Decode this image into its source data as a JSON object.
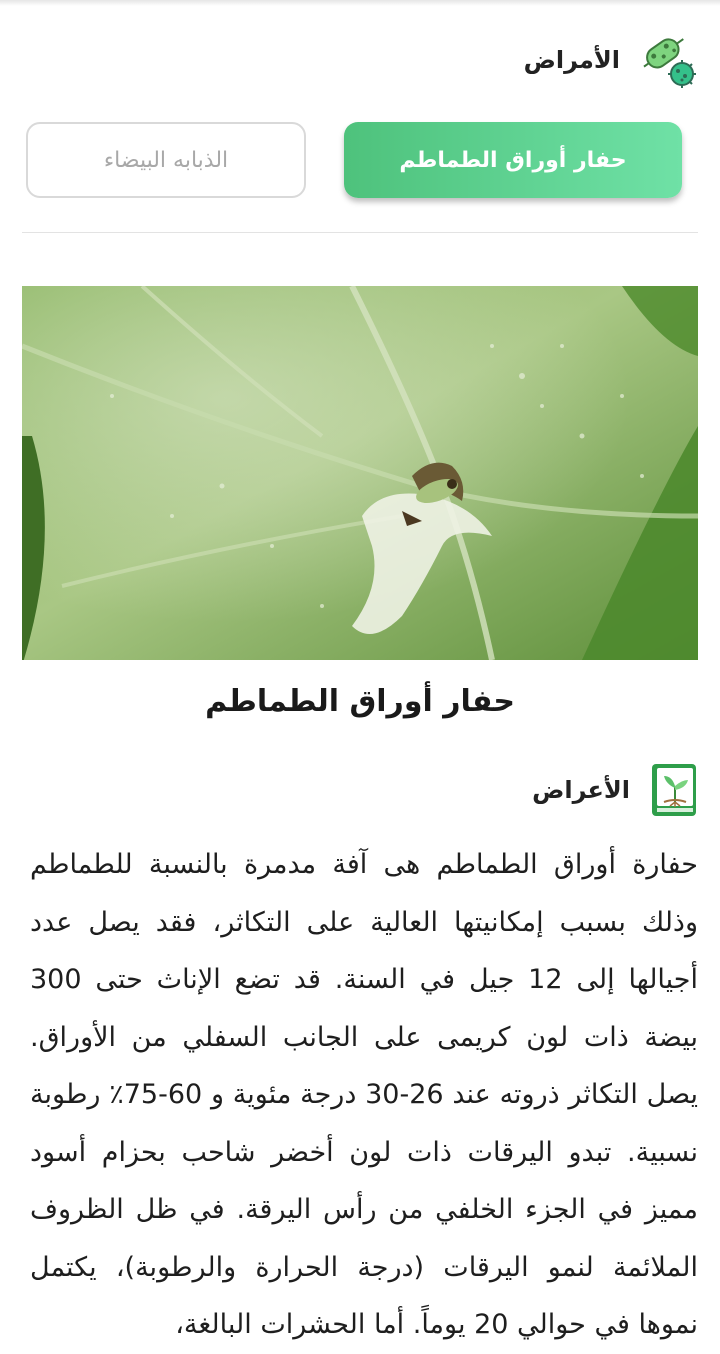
{
  "header": {
    "title": "الأمراض",
    "icon": "bacteria-icon"
  },
  "tabs": [
    {
      "label": "حفار أوراق الطماطم",
      "active": true
    },
    {
      "label": "الذبابه البيضاء",
      "active": false
    }
  ],
  "colors": {
    "accent_start": "#4ec27c",
    "accent_end": "#6fe1a6",
    "icon_green": "#2e9e4a"
  },
  "pest": {
    "image": "tomato-leafminer-photo",
    "title": "حفار أوراق الطماطم"
  },
  "symptoms": {
    "label": "الأعراض",
    "icon": "plant-book-icon",
    "text": "حفارة أوراق الطماطم هى آفة مدمرة بالنسبة للطماطم وذلك بسبب إمكانيتها العالية على التكاثر، فقد يصل عدد أجيالها إلى 12 جيل في السنة. قد تضع الإناث حتى 300 بيضة ذات لون كريمى على الجانب السفلي من الأوراق. يصل التكاثر ذروته عند 26-30 درجة مئوية و 60-75٪ رطوبة نسبية. تبدو اليرقات ذات لون أخضر شاحب بحزام أسود مميز في الجزء الخلفي من رأس اليرقة. في ظل الظروف الملائمة لنمو اليرقات (درجة الحرارة والرطوبة)، يكتمل نموها في حوالي 20 يوماً. أما الحشرات البالغة،"
  }
}
